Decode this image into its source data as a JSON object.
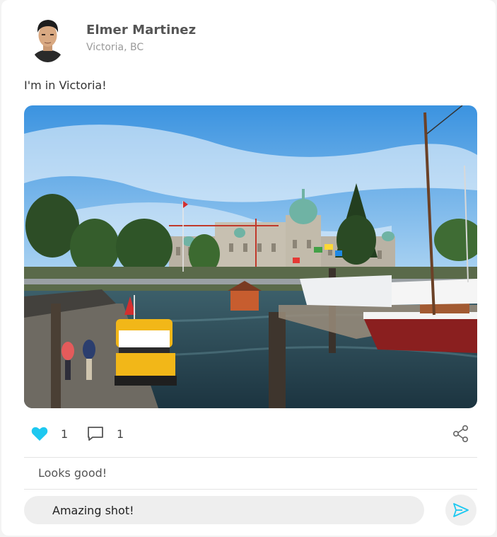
{
  "post": {
    "author_name": "Elmer Martinez",
    "author_location": "Victoria, BC",
    "text": "I'm in Victoria!",
    "image_icon": "harbour-photo"
  },
  "actions": {
    "like_icon": "heart-icon",
    "like_count": "1",
    "like_color": "#1ec8f0",
    "comment_icon": "comment-icon",
    "comment_count": "1",
    "share_icon": "share-icon"
  },
  "comments": [
    {
      "text": "Looks good!"
    }
  ],
  "composer": {
    "value": "Amazing shot!",
    "send_icon": "send-icon",
    "accent": "#1ec8f0"
  }
}
